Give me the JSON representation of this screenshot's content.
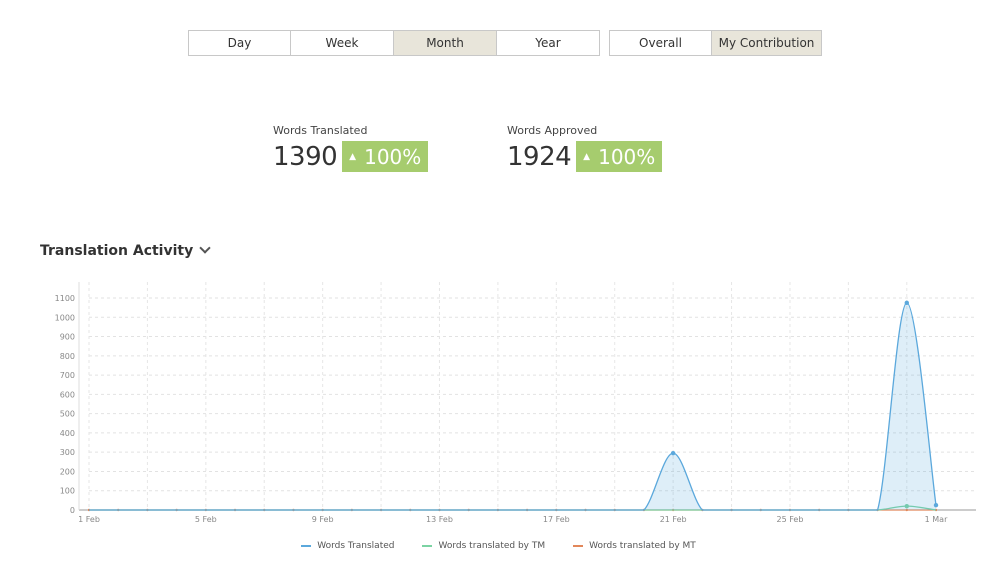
{
  "period_buttons": [
    {
      "label": "Day",
      "active": false
    },
    {
      "label": "Week",
      "active": false
    },
    {
      "label": "Month",
      "active": true
    },
    {
      "label": "Year",
      "active": false
    }
  ],
  "scope_buttons": [
    {
      "label": "Overall",
      "active": false
    },
    {
      "label": "My Contribution",
      "active": true
    }
  ],
  "stats": {
    "translated": {
      "label": "Words Translated",
      "value": "1390",
      "change": "100%"
    },
    "approved": {
      "label": "Words Approved",
      "value": "1924",
      "change": "100%"
    }
  },
  "section": {
    "title": "Translation Activity"
  },
  "colors": {
    "translated": "#5ba8dc",
    "tm": "#7bd3a3",
    "mt": "#e2875a",
    "badge": "#a6cc6e",
    "active_button": "#e8e5da"
  },
  "chart_data": {
    "type": "area",
    "x": [
      "1 Feb",
      "2 Feb",
      "3 Feb",
      "4 Feb",
      "5 Feb",
      "6 Feb",
      "7 Feb",
      "8 Feb",
      "9 Feb",
      "10 Feb",
      "11 Feb",
      "12 Feb",
      "13 Feb",
      "14 Feb",
      "15 Feb",
      "16 Feb",
      "17 Feb",
      "18 Feb",
      "19 Feb",
      "20 Feb",
      "21 Feb",
      "22 Feb",
      "23 Feb",
      "24 Feb",
      "25 Feb",
      "26 Feb",
      "27 Feb",
      "28 Feb",
      "29 Feb",
      "1 Mar"
    ],
    "x_tick_labels": [
      "1 Feb",
      "5 Feb",
      "9 Feb",
      "13 Feb",
      "17 Feb",
      "21 Feb",
      "25 Feb",
      "1 Mar"
    ],
    "series": [
      {
        "name": "Words Translated",
        "values": [
          0,
          0,
          0,
          0,
          0,
          0,
          0,
          0,
          0,
          0,
          0,
          0,
          0,
          0,
          0,
          0,
          0,
          0,
          0,
          0,
          295,
          0,
          0,
          0,
          0,
          0,
          0,
          0,
          1075,
          25
        ]
      },
      {
        "name": "Words translated by TM",
        "values": [
          0,
          0,
          0,
          0,
          0,
          0,
          0,
          0,
          0,
          0,
          0,
          0,
          0,
          0,
          0,
          0,
          0,
          0,
          0,
          0,
          0,
          0,
          0,
          0,
          0,
          0,
          0,
          0,
          20,
          0
        ]
      },
      {
        "name": "Words translated by MT",
        "values": [
          0,
          0,
          0,
          0,
          0,
          0,
          0,
          0,
          0,
          0,
          0,
          0,
          0,
          0,
          0,
          0,
          0,
          0,
          0,
          0,
          0,
          0,
          0,
          0,
          0,
          0,
          0,
          0,
          0,
          0
        ]
      }
    ],
    "ylim": [
      0,
      1100
    ],
    "yticks": [
      0,
      100,
      200,
      300,
      400,
      500,
      600,
      700,
      800,
      900,
      1000,
      1100
    ],
    "grid": true,
    "legend": "bottom"
  }
}
